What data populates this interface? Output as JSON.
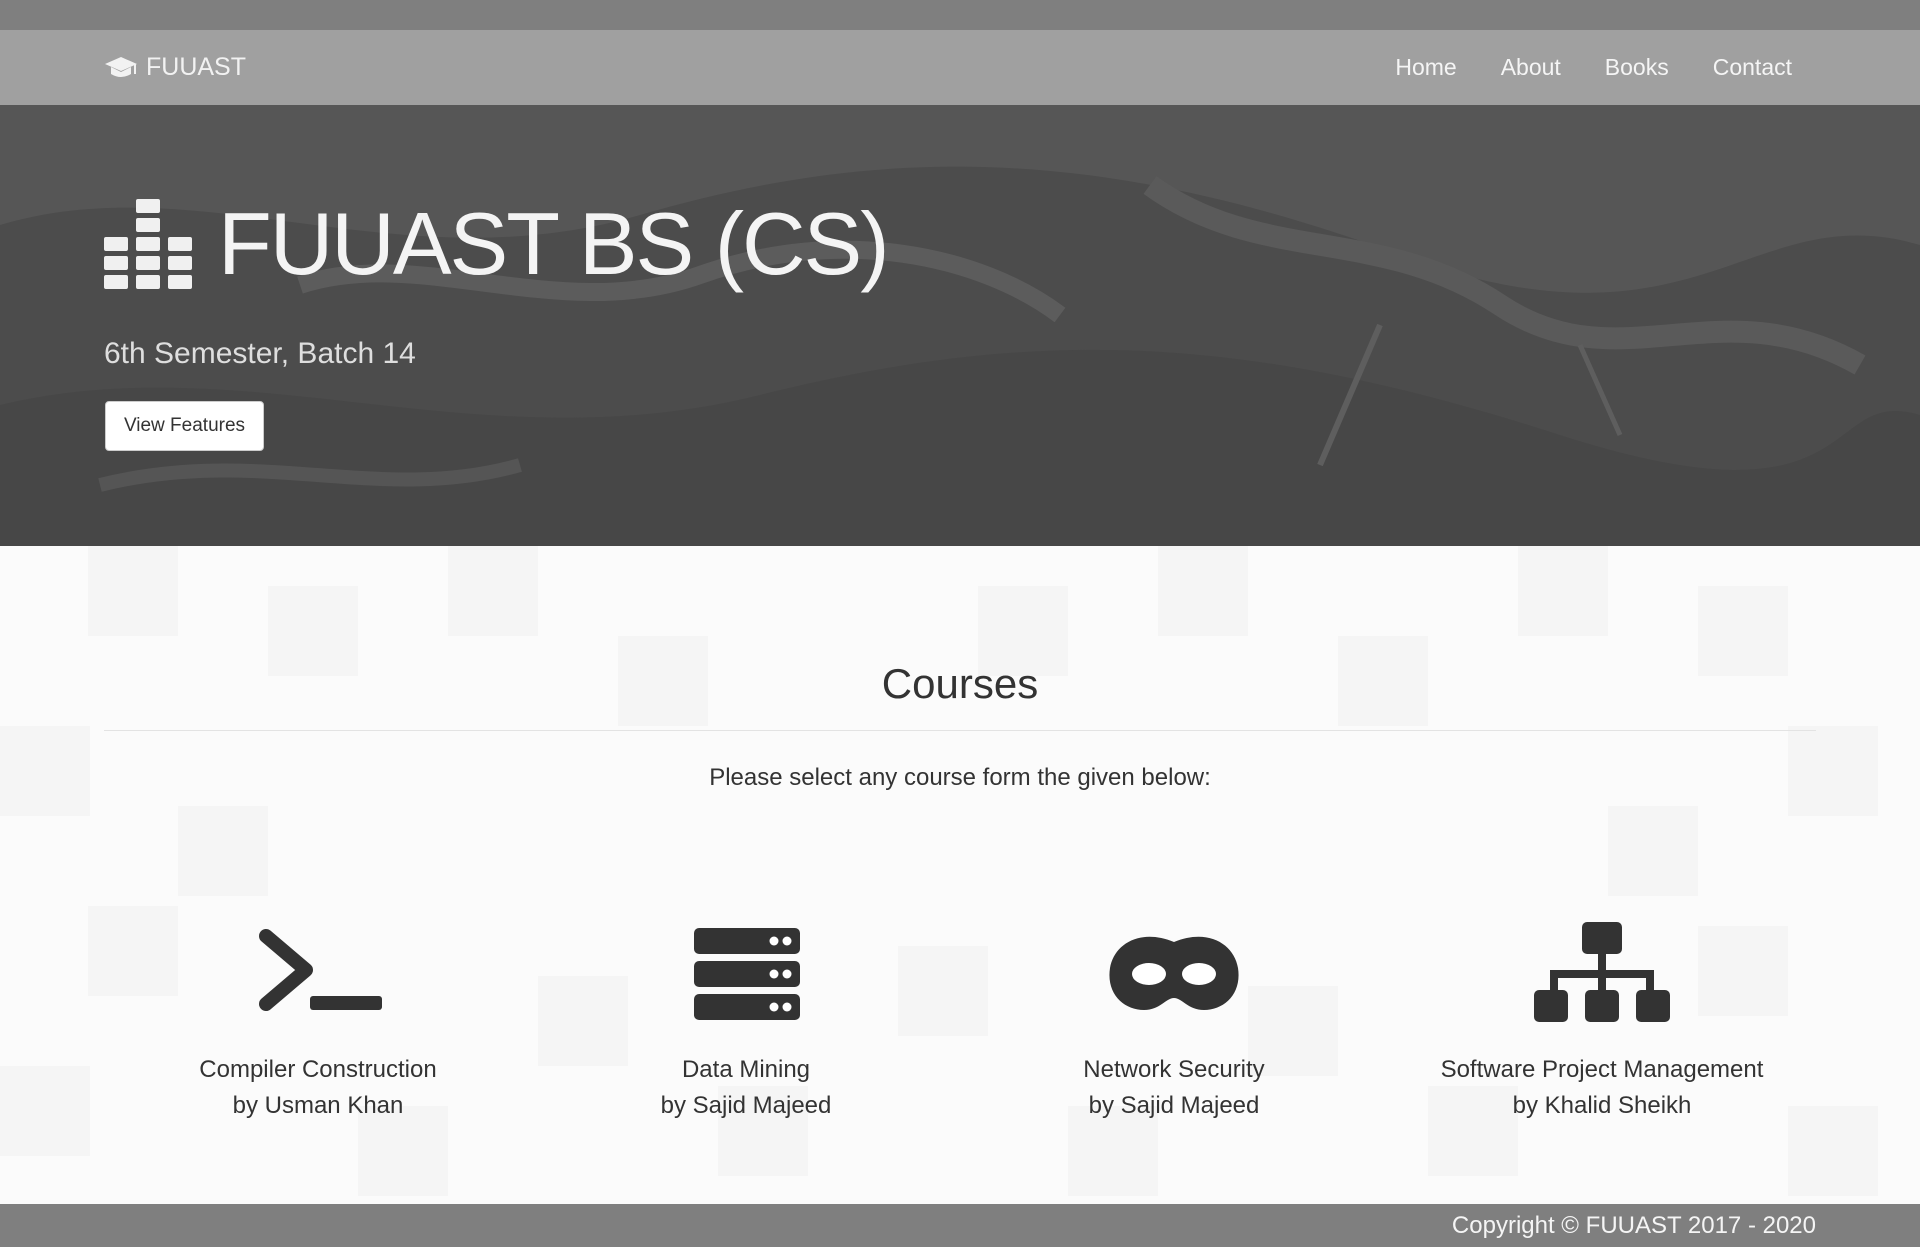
{
  "navbar": {
    "brand_icon": "graduation-cap-icon",
    "brand_label": "FUUAST",
    "links": [
      {
        "label": "Home"
      },
      {
        "label": "About"
      },
      {
        "label": "Books"
      },
      {
        "label": "Contact"
      }
    ]
  },
  "hero": {
    "icon": "server-rack-icon",
    "title": "FUUAST BS (CS)",
    "subtitle": "6th Semester, Batch 14",
    "button_label": "View Features"
  },
  "courses": {
    "title": "Courses",
    "intro": "Please select any course form the given below:",
    "items": [
      {
        "icon": "terminal-icon",
        "name": "Compiler Construction",
        "teacher": "by Usman Khan"
      },
      {
        "icon": "database-icon",
        "name": "Data Mining",
        "teacher": "by Sajid Majeed"
      },
      {
        "icon": "mask-icon",
        "name": "Network Security",
        "teacher": "by Sajid Majeed"
      },
      {
        "icon": "sitemap-icon",
        "name": "Software Project Management",
        "teacher": "by Khalid Sheikh"
      }
    ]
  },
  "footer": {
    "copyright": "Copyright © FUUAST 2017 - 2020"
  },
  "colors": {
    "navbar_bg": "#a0a0a0",
    "top_strip": "#7f7f7f",
    "hero_bg": "#4a4a4a",
    "icon_dark": "#333333",
    "footer_bg": "#7f7f7f"
  }
}
